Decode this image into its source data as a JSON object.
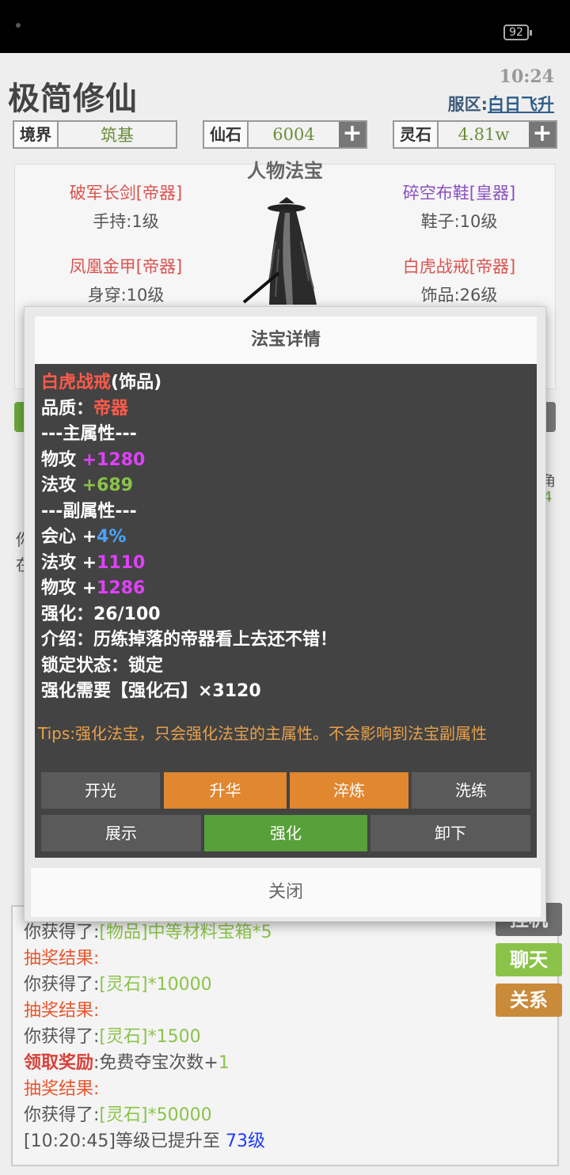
{
  "status_bar": {
    "battery": "92"
  },
  "header": {
    "app_title": "极简修仙",
    "time": "10:24",
    "server_label": "服区:",
    "server_name": "白日飞升"
  },
  "resources": {
    "realm": {
      "label": "境界",
      "value": "筑基"
    },
    "xianshi": {
      "label": "仙石",
      "value": "6004"
    },
    "lingshi": {
      "label": "灵石",
      "value": "4.81w"
    }
  },
  "equipment_panel": {
    "title": "人物法宝",
    "items": [
      {
        "name": "破军长剑[帝器]",
        "slot": "手持:1级"
      },
      {
        "name": "碎空布鞋[皇器]",
        "slot": "鞋子:10级"
      },
      {
        "name": "凤凰金甲[帝器]",
        "slot": "身穿:10级"
      },
      {
        "name": "白虎战戒[帝器]",
        "slot": "饰品:26级"
      }
    ]
  },
  "behind_partial": {
    "right_a": "角",
    "right_b": "4",
    "left_a": "你",
    "left_b": "在"
  },
  "dialog": {
    "title": "法宝详情",
    "item_name": "白虎战戒",
    "item_type": "(饰品)",
    "quality_label": "品质：",
    "quality_value": "帝器",
    "main_header": "---主属性---",
    "main_attrs": [
      {
        "name": "物攻",
        "value": "+1280"
      },
      {
        "name": "法攻",
        "value": "+689"
      }
    ],
    "sub_header": "---副属性---",
    "sub_attrs": [
      {
        "name": "会心",
        "sign": "+",
        "value": "4%"
      },
      {
        "name": "法攻",
        "sign": "+",
        "value": "1110"
      },
      {
        "name": "物攻",
        "sign": "+",
        "value": "1286"
      }
    ],
    "enhance": "强化：26/100",
    "intro": "介绍：历练掉落的帝器看上去还不错！",
    "lock": "锁定状态：锁定",
    "requirement": "强化需要【强化石】×3120",
    "tips": "Tips:强化法宝，只会强化法宝的主属性。不会影响到法宝副属性",
    "buttons_row1": [
      "开光",
      "升华",
      "淬炼",
      "洗练"
    ],
    "buttons_row2": [
      "展示",
      "强化",
      "卸下"
    ],
    "close": "关闭"
  },
  "log": [
    {
      "parts": [
        [
          "你获得了:",
          ""
        ],
        [
          "[物品]中等材料宝箱*5",
          "l-green"
        ]
      ]
    },
    {
      "parts": [
        [
          "抽奖结果:",
          "l-orange"
        ]
      ]
    },
    {
      "parts": [
        [
          "你获得了:",
          ""
        ],
        [
          "[灵石]*10000",
          "l-green"
        ]
      ]
    },
    {
      "parts": [
        [
          "抽奖结果:",
          "l-orange"
        ]
      ]
    },
    {
      "parts": [
        [
          "你获得了:",
          ""
        ],
        [
          "[灵石]*1500",
          "l-green"
        ]
      ]
    },
    {
      "parts": [
        [
          "领取奖励",
          "l-redb"
        ],
        [
          ":免费夺宝次数+",
          ""
        ],
        [
          "1",
          "l-green"
        ]
      ]
    },
    {
      "parts": [
        [
          "抽奖结果:",
          "l-orange"
        ]
      ]
    },
    {
      "parts": [
        [
          "你获得了:",
          ""
        ],
        [
          "[灵石]*50000",
          "l-green"
        ]
      ]
    },
    {
      "parts": [
        [
          "[10:20:45]等级已提升至 ",
          ""
        ],
        [
          "73级",
          "l-blue"
        ]
      ]
    }
  ],
  "side_buttons": [
    {
      "label": "挂机",
      "color": "#6f6f6f"
    },
    {
      "label": "聊天",
      "color": "#8bc34a"
    },
    {
      "label": "关系",
      "color": "#c98a3a"
    }
  ]
}
